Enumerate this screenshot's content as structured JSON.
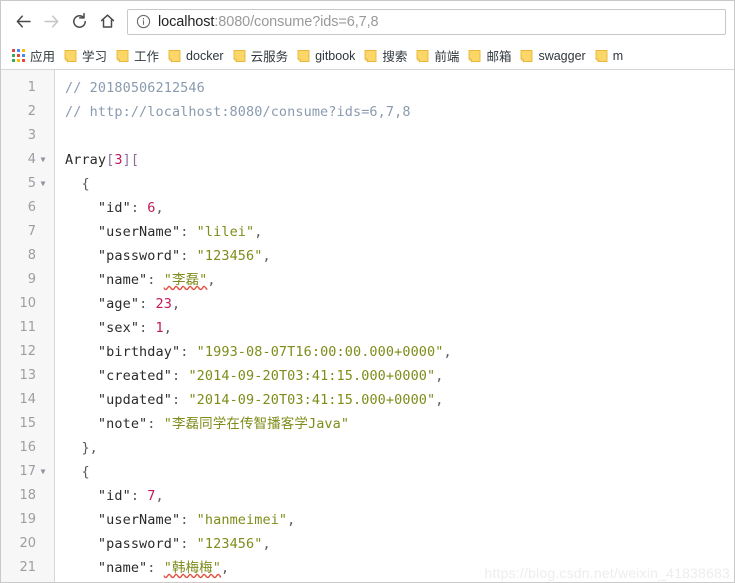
{
  "browser": {
    "nav": {
      "back_label": "Back",
      "forward_label": "Forward",
      "reload_label": "Reload",
      "home_label": "Home"
    },
    "address_bar": {
      "info_icon": "info-circle-icon",
      "host": "localhost",
      "path": ":8080/consume?ids=6,7,8",
      "full_url": "localhost:8080/consume?ids=6,7,8"
    },
    "bookmarks": {
      "apps_label": "应用",
      "items": [
        {
          "label": "学习",
          "icon": "folder-icon"
        },
        {
          "label": "工作",
          "icon": "folder-icon"
        },
        {
          "label": "docker",
          "icon": "folder-icon"
        },
        {
          "label": "云服务",
          "icon": "folder-icon"
        },
        {
          "label": "gitbook",
          "icon": "folder-icon"
        },
        {
          "label": "搜索",
          "icon": "folder-icon"
        },
        {
          "label": "前端",
          "icon": "folder-icon"
        },
        {
          "label": "邮箱",
          "icon": "folder-icon"
        },
        {
          "label": "swagger",
          "icon": "folder-icon"
        },
        {
          "label": "m",
          "icon": "folder-icon"
        }
      ]
    }
  },
  "viewer": {
    "watermark": "https://blog.csdn.net/weixin_41838683",
    "colors": {
      "comment": "#8a9bb0",
      "key": "#2b2b2b",
      "string": "#7f8c1a",
      "number": "#c2185b",
      "bracket": "#8b6f9e",
      "gutter_bg": "#f7f7f7",
      "line_number": "#9e9e9e"
    },
    "lines": [
      {
        "n": 1,
        "fold": false,
        "tokens": [
          {
            "t": "comment",
            "v": "// 20180506212546"
          }
        ]
      },
      {
        "n": 2,
        "fold": false,
        "tokens": [
          {
            "t": "comment",
            "v": "// http://localhost:8080/consume?ids=6,7,8"
          }
        ]
      },
      {
        "n": 3,
        "fold": false,
        "tokens": []
      },
      {
        "n": 4,
        "fold": true,
        "tokens": [
          {
            "t": "plain",
            "v": "Array"
          },
          {
            "t": "bracket",
            "v": "["
          },
          {
            "t": "num",
            "v": "3"
          },
          {
            "t": "bracket",
            "v": "]["
          }
        ]
      },
      {
        "n": 5,
        "fold": true,
        "tokens": [
          {
            "t": "punct",
            "v": "  {"
          }
        ]
      },
      {
        "n": 6,
        "fold": false,
        "tokens": [
          {
            "t": "key",
            "v": "    \"id\""
          },
          {
            "t": "punct",
            "v": ": "
          },
          {
            "t": "num",
            "v": "6"
          },
          {
            "t": "punct",
            "v": ","
          }
        ]
      },
      {
        "n": 7,
        "fold": false,
        "tokens": [
          {
            "t": "key",
            "v": "    \"userName\""
          },
          {
            "t": "punct",
            "v": ": "
          },
          {
            "t": "str",
            "v": "\"lilei\""
          },
          {
            "t": "punct",
            "v": ","
          }
        ]
      },
      {
        "n": 8,
        "fold": false,
        "tokens": [
          {
            "t": "key",
            "v": "    \"password\""
          },
          {
            "t": "punct",
            "v": ": "
          },
          {
            "t": "str",
            "v": "\"123456\""
          },
          {
            "t": "punct",
            "v": ","
          }
        ]
      },
      {
        "n": 9,
        "fold": false,
        "tokens": [
          {
            "t": "key",
            "v": "    \"name\""
          },
          {
            "t": "punct",
            "v": ": "
          },
          {
            "t": "str-spell",
            "v": "\"李磊\""
          },
          {
            "t": "punct",
            "v": ","
          }
        ]
      },
      {
        "n": 10,
        "fold": false,
        "tokens": [
          {
            "t": "key",
            "v": "    \"age\""
          },
          {
            "t": "punct",
            "v": ": "
          },
          {
            "t": "num",
            "v": "23"
          },
          {
            "t": "punct",
            "v": ","
          }
        ]
      },
      {
        "n": 11,
        "fold": false,
        "tokens": [
          {
            "t": "key",
            "v": "    \"sex\""
          },
          {
            "t": "punct",
            "v": ": "
          },
          {
            "t": "num",
            "v": "1"
          },
          {
            "t": "punct",
            "v": ","
          }
        ]
      },
      {
        "n": 12,
        "fold": false,
        "tokens": [
          {
            "t": "key",
            "v": "    \"birthday\""
          },
          {
            "t": "punct",
            "v": ": "
          },
          {
            "t": "str",
            "v": "\"1993-08-07T16:00:00.000+0000\""
          },
          {
            "t": "punct",
            "v": ","
          }
        ]
      },
      {
        "n": 13,
        "fold": false,
        "tokens": [
          {
            "t": "key",
            "v": "    \"created\""
          },
          {
            "t": "punct",
            "v": ": "
          },
          {
            "t": "str",
            "v": "\"2014-09-20T03:41:15.000+0000\""
          },
          {
            "t": "punct",
            "v": ","
          }
        ]
      },
      {
        "n": 14,
        "fold": false,
        "tokens": [
          {
            "t": "key",
            "v": "    \"updated\""
          },
          {
            "t": "punct",
            "v": ": "
          },
          {
            "t": "str",
            "v": "\"2014-09-20T03:41:15.000+0000\""
          },
          {
            "t": "punct",
            "v": ","
          }
        ]
      },
      {
        "n": 15,
        "fold": false,
        "tokens": [
          {
            "t": "key",
            "v": "    \"note\""
          },
          {
            "t": "punct",
            "v": ": "
          },
          {
            "t": "str",
            "v": "\"李磊同学在传智播客学Java\""
          }
        ]
      },
      {
        "n": 16,
        "fold": false,
        "tokens": [
          {
            "t": "punct",
            "v": "  },"
          }
        ]
      },
      {
        "n": 17,
        "fold": true,
        "tokens": [
          {
            "t": "punct",
            "v": "  {"
          }
        ]
      },
      {
        "n": 18,
        "fold": false,
        "tokens": [
          {
            "t": "key",
            "v": "    \"id\""
          },
          {
            "t": "punct",
            "v": ": "
          },
          {
            "t": "num",
            "v": "7"
          },
          {
            "t": "punct",
            "v": ","
          }
        ]
      },
      {
        "n": 19,
        "fold": false,
        "tokens": [
          {
            "t": "key",
            "v": "    \"userName\""
          },
          {
            "t": "punct",
            "v": ": "
          },
          {
            "t": "str",
            "v": "\"hanmeimei\""
          },
          {
            "t": "punct",
            "v": ","
          }
        ]
      },
      {
        "n": 20,
        "fold": false,
        "tokens": [
          {
            "t": "key",
            "v": "    \"password\""
          },
          {
            "t": "punct",
            "v": ": "
          },
          {
            "t": "str",
            "v": "\"123456\""
          },
          {
            "t": "punct",
            "v": ","
          }
        ]
      },
      {
        "n": 21,
        "fold": false,
        "tokens": [
          {
            "t": "key",
            "v": "    \"name\""
          },
          {
            "t": "punct",
            "v": ": "
          },
          {
            "t": "str-spell",
            "v": "\"韩梅梅\""
          },
          {
            "t": "punct",
            "v": ","
          }
        ]
      }
    ]
  }
}
